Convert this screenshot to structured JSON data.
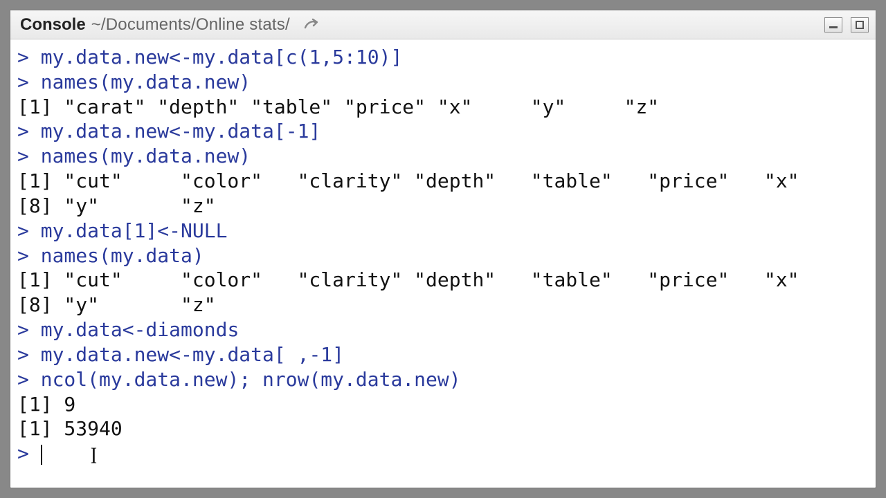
{
  "titlebar": {
    "label": "Console",
    "path": "~/Documents/Online stats/",
    "popout_icon": "popout-arrow-icon",
    "min_label": "minimize",
    "max_label": "maximize"
  },
  "console": {
    "prompt": ">",
    "lines": [
      {
        "type": "cmd",
        "text": "my.data.new<-my.data[c(1,5:10)]"
      },
      {
        "type": "cmd",
        "text": "names(my.data.new)"
      },
      {
        "type": "out",
        "text": "[1] \"carat\" \"depth\" \"table\" \"price\" \"x\"     \"y\"     \"z\""
      },
      {
        "type": "cmd",
        "text": "my.data.new<-my.data[-1]"
      },
      {
        "type": "cmd",
        "text": "names(my.data.new)"
      },
      {
        "type": "out",
        "text": "[1] \"cut\"     \"color\"   \"clarity\" \"depth\"   \"table\"   \"price\"   \"x\""
      },
      {
        "type": "out",
        "text": "[8] \"y\"       \"z\""
      },
      {
        "type": "cmd",
        "text": "my.data[1]<-NULL"
      },
      {
        "type": "cmd",
        "text": "names(my.data)"
      },
      {
        "type": "out",
        "text": "[1] \"cut\"     \"color\"   \"clarity\" \"depth\"   \"table\"   \"price\"   \"x\""
      },
      {
        "type": "out",
        "text": "[8] \"y\"       \"z\""
      },
      {
        "type": "cmd",
        "text": "my.data<-diamonds"
      },
      {
        "type": "cmd",
        "text": "my.data.new<-my.data[ ,-1]"
      },
      {
        "type": "cmd",
        "text": "ncol(my.data.new); nrow(my.data.new)"
      },
      {
        "type": "out",
        "text": "[1] 9"
      },
      {
        "type": "out",
        "text": "[1] 53940"
      }
    ],
    "current_input": ""
  }
}
